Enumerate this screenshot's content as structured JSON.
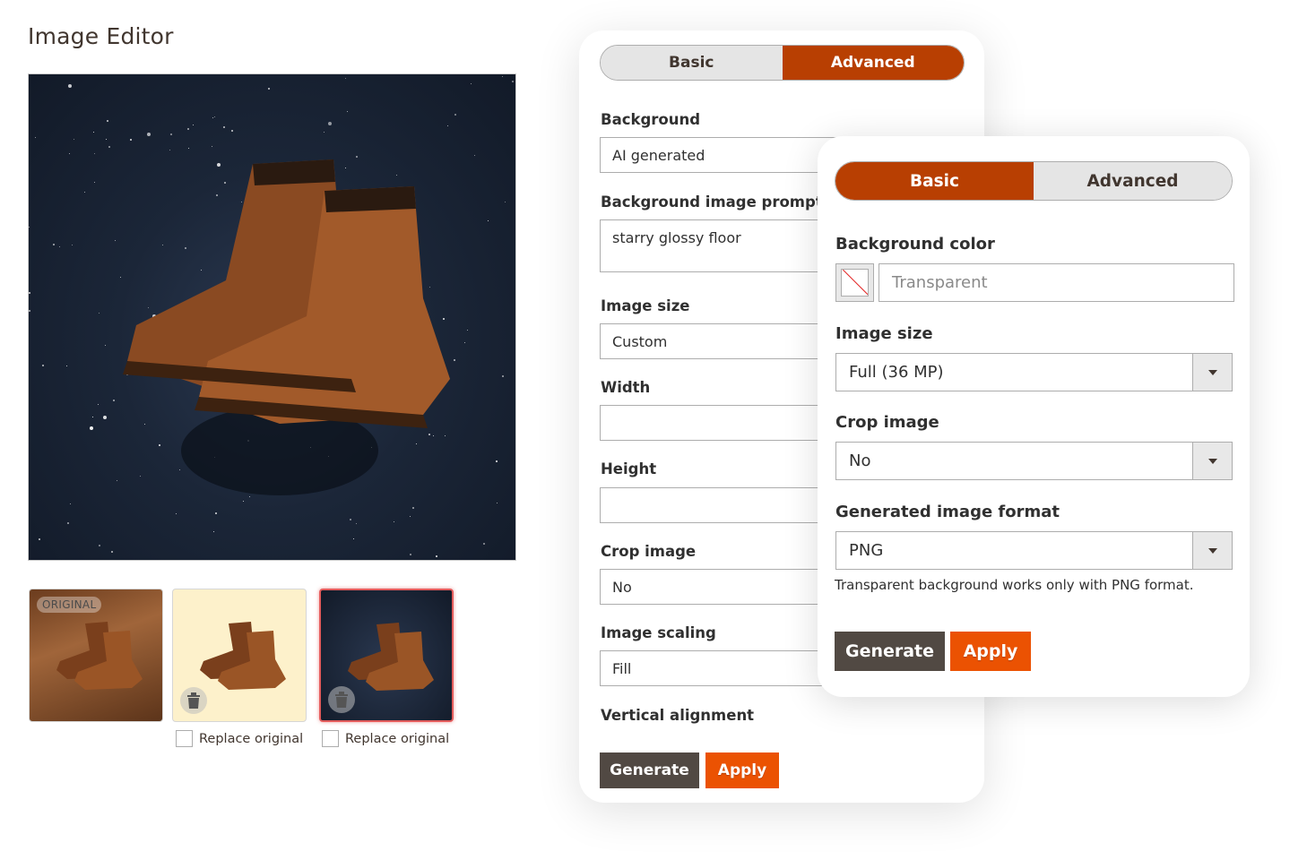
{
  "page": {
    "title": "Image Editor"
  },
  "thumbnails": [
    {
      "badge": "ORIGINAL",
      "background": "wooden floor"
    },
    {
      "background": "cream",
      "replace_label": "Replace original",
      "replace_checked": false
    },
    {
      "background": "starry glossy floor",
      "selected": true,
      "replace_label": "Replace original",
      "replace_checked": false
    }
  ],
  "advanced_panel": {
    "tabs": [
      {
        "label": "Basic",
        "active": false
      },
      {
        "label": "Advanced",
        "active": true
      }
    ],
    "fields": {
      "background": {
        "label": "Background",
        "value": "AI generated"
      },
      "prompt": {
        "label": "Background image prompt",
        "value": "starry glossy floor"
      },
      "image_size": {
        "label": "Image size",
        "value": "Custom"
      },
      "width": {
        "label": "Width",
        "value": ""
      },
      "height": {
        "label": "Height",
        "value": ""
      },
      "crop": {
        "label": "Crop image",
        "value": "No"
      },
      "scaling": {
        "label": "Image scaling",
        "value": "Fill"
      },
      "valign": {
        "label": "Vertical alignment"
      }
    },
    "buttons": {
      "generate": "Generate",
      "apply": "Apply"
    }
  },
  "basic_panel": {
    "tabs": [
      {
        "label": "Basic",
        "active": true
      },
      {
        "label": "Advanced",
        "active": false
      }
    ],
    "fields": {
      "bg_color": {
        "label": "Background color",
        "placeholder": "Transparent"
      },
      "image_size": {
        "label": "Image size",
        "value": "Full (36 MP)"
      },
      "crop": {
        "label": "Crop image",
        "value": "No"
      },
      "format": {
        "label": "Generated image format",
        "value": "PNG",
        "note": "Transparent background works only with PNG format."
      }
    },
    "buttons": {
      "generate": "Generate",
      "apply": "Apply"
    }
  },
  "colors": {
    "accent": "#eb5202",
    "tab_active": "#b83f02",
    "button_dark": "#514943",
    "selected_border": "#e35c5c"
  }
}
